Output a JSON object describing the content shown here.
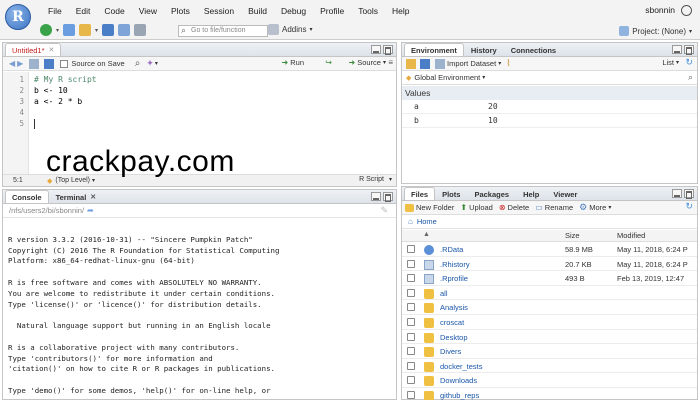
{
  "menubar": {
    "logo": "R",
    "items": [
      "File",
      "Edit",
      "Code",
      "View",
      "Plots",
      "Session",
      "Build",
      "Debug",
      "Profile",
      "Tools",
      "Help"
    ],
    "user": "sbonnin"
  },
  "toolbar": {
    "goto_placeholder": "Go to file/function",
    "addins_label": "Addins",
    "project_label": "Project: (None)"
  },
  "editor": {
    "tab_label": "Untitled1*",
    "source_on_save": "Source on Save",
    "run_label": "Run",
    "source_label": "Source",
    "lines": [
      {
        "n": "1",
        "text": "# My R script"
      },
      {
        "n": "2",
        "text": "b <- 10"
      },
      {
        "n": "3",
        "text": "a <- 2 * b"
      },
      {
        "n": "4",
        "text": ""
      },
      {
        "n": "5",
        "text": ""
      }
    ],
    "status_pos": "5:1",
    "status_level": "(Top Level)",
    "status_type": "R Script"
  },
  "watermark": "crackpay.com",
  "console": {
    "tabs": [
      "Console",
      "Terminal"
    ],
    "path": "/nfs/users2/bi/sbonnin/",
    "lines": [
      "",
      "R version 3.3.2 (2016-10-31) -- \"Sincere Pumpkin Patch\"",
      "Copyright (C) 2016 The R Foundation for Statistical Computing",
      "Platform: x86_64-redhat-linux-gnu (64-bit)",
      "",
      "R is free software and comes with ABSOLUTELY NO WARRANTY.",
      "You are welcome to redistribute it under certain conditions.",
      "Type 'license()' or 'licence()' for distribution details.",
      "",
      "  Natural language support but running in an English locale",
      "",
      "R is a collaborative project with many contributors.",
      "Type 'contributors()' for more information and",
      "'citation()' on how to cite R or R packages in publications.",
      "",
      "Type 'demo()' for some demos, 'help()' for on-line help, or"
    ]
  },
  "environment": {
    "tabs": [
      "Environment",
      "History",
      "Connections"
    ],
    "import_label": "Import Dataset",
    "list_label": "List",
    "scope_label": "Global Environment",
    "section": "Values",
    "rows": [
      {
        "name": "a",
        "value": "20"
      },
      {
        "name": "b",
        "value": "10"
      }
    ]
  },
  "files": {
    "tabs": [
      "Files",
      "Plots",
      "Packages",
      "Help",
      "Viewer"
    ],
    "new_folder": "New Folder",
    "upload": "Upload",
    "delete": "Delete",
    "rename": "Rename",
    "more": "More",
    "breadcrumb": "Home",
    "col_size": "Size",
    "col_modified": "Modified",
    "rows": [
      {
        "name": ".RData",
        "size": "58.9 MB",
        "modified": "May 11, 2018, 6:24 P",
        "type": "rdata"
      },
      {
        "name": ".Rhistory",
        "size": "20.7 KB",
        "modified": "May 11, 2018, 6:24 P",
        "type": "doc"
      },
      {
        "name": ".Rprofile",
        "size": "493 B",
        "modified": "Feb 13, 2019, 12:47",
        "type": "doc"
      },
      {
        "name": "all",
        "size": "",
        "modified": "",
        "type": "folder"
      },
      {
        "name": "Analysis",
        "size": "",
        "modified": "",
        "type": "folder"
      },
      {
        "name": "croscat",
        "size": "",
        "modified": "",
        "type": "folder"
      },
      {
        "name": "Desktop",
        "size": "",
        "modified": "",
        "type": "folder"
      },
      {
        "name": "Divers",
        "size": "",
        "modified": "",
        "type": "folder"
      },
      {
        "name": "docker_tests",
        "size": "",
        "modified": "",
        "type": "folder"
      },
      {
        "name": "Downloads",
        "size": "",
        "modified": "",
        "type": "folder"
      },
      {
        "name": "github_reps",
        "size": "",
        "modified": "",
        "type": "folder"
      }
    ]
  }
}
